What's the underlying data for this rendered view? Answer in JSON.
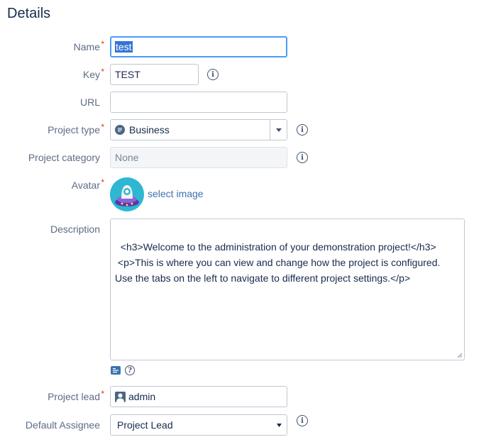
{
  "section": {
    "title": "Details"
  },
  "name": {
    "label": "Name",
    "value": "test"
  },
  "key": {
    "label": "Key",
    "value": "TEST"
  },
  "url": {
    "label": "URL",
    "value": ""
  },
  "project_type": {
    "label": "Project type",
    "value": "Business",
    "icon": "business-type-icon"
  },
  "project_category": {
    "label": "Project category",
    "placeholder": "None"
  },
  "avatar": {
    "label": "Avatar",
    "link": "select image"
  },
  "description": {
    "label": "Description",
    "value": "<h3>Welcome to the administration of your demonstration project!</h3>\n <p>This is where you can view and change how the project is configured. Use the tabs on the left to navigate to different project settings.</p>"
  },
  "project_lead": {
    "label": "Project lead",
    "value": "admin"
  },
  "default_assignee": {
    "label": "Default Assignee",
    "value": "Project Lead"
  },
  "required_marker": "*",
  "info_glyph": "i",
  "help_glyph": "?",
  "colors": {
    "accent": "#4c9aff",
    "required": "#de350b",
    "link": "#3b73af"
  }
}
